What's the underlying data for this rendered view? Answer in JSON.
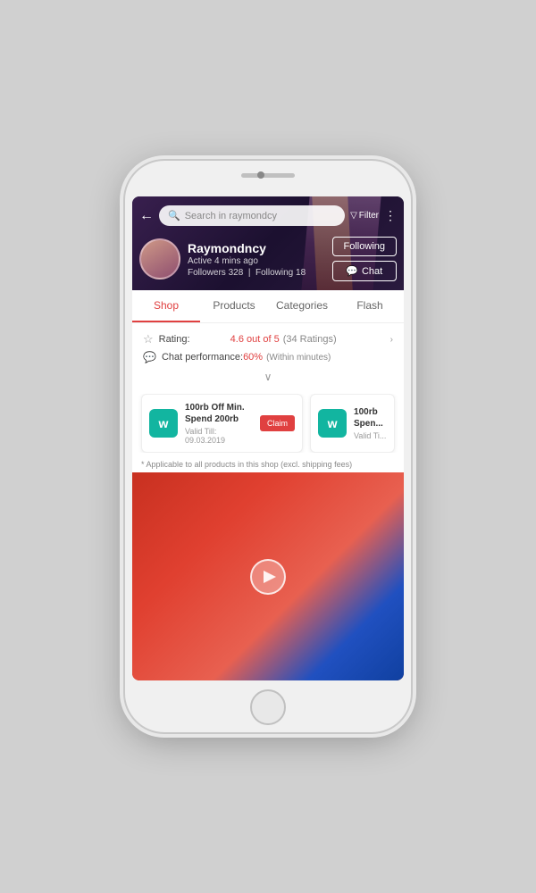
{
  "phone": {
    "speaker_aria": "phone-speaker",
    "camera_aria": "phone-camera"
  },
  "header": {
    "search_placeholder": "Search in raymondcy",
    "filter_label": "Filter",
    "back_aria": "back"
  },
  "profile": {
    "name": "Raymondncy",
    "status": "Active 4 mins ago",
    "followers_label": "Followers",
    "followers_count": "328",
    "following_label": "Following",
    "following_count": "18",
    "following_btn": "Following",
    "chat_btn": "Chat"
  },
  "tabs": [
    {
      "label": "Shop",
      "active": true
    },
    {
      "label": "Products",
      "active": false
    },
    {
      "label": "Categories",
      "active": false
    },
    {
      "label": "Flash",
      "active": false
    }
  ],
  "rating": {
    "label": "Rating:",
    "value": "4.6 out of 5",
    "count": "(34 Ratings)"
  },
  "chat_performance": {
    "label": "Chat performance:",
    "value": "60%",
    "note": "(Within minutes)"
  },
  "expand_icon": "∨",
  "vouchers": [
    {
      "logo": "w",
      "title": "100rb Off Min. Spend 200rb",
      "validity": "Valid Till: 09.03.2019",
      "has_claim": true,
      "claim_label": "Claim"
    },
    {
      "logo": "w",
      "title": "100rb",
      "validity": "Valid Ti...",
      "has_claim": false,
      "claim_label": ""
    }
  ],
  "disclaimer": "* Applicable to all products in this shop (excl. shipping fees)",
  "video": {
    "play_aria": "play"
  }
}
